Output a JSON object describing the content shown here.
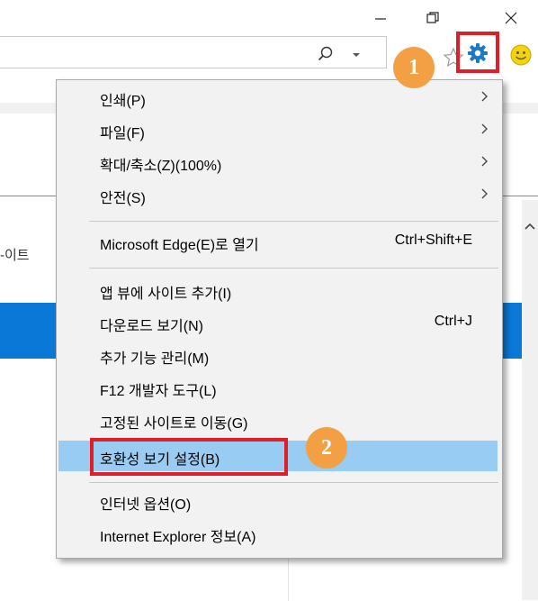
{
  "window_controls": [
    {
      "name": "minimize-icon"
    },
    {
      "name": "restore-icon"
    },
    {
      "name": "close-icon"
    }
  ],
  "toolbar": {
    "icons": [
      "search-icon",
      "chevron-down-icon",
      "star-icon",
      "gear-icon",
      "smiley-icon"
    ],
    "accent_highlight": "#e01e28",
    "callout_color": "#f2a043"
  },
  "callouts": [
    "1",
    "2"
  ],
  "background_page": {
    "tab_text": "-이트",
    "accent": "#0a78d7"
  },
  "menu": {
    "highlight_color": "#99ccf2",
    "items": [
      {
        "label": "인쇄(P)",
        "shortcut": "",
        "has_submenu": true
      },
      {
        "label": "파일(F)",
        "shortcut": "",
        "has_submenu": true
      },
      {
        "label": "확대/축소(Z)(100%)",
        "shortcut": "",
        "has_submenu": true
      },
      {
        "label": "안전(S)",
        "shortcut": "",
        "has_submenu": true
      },
      {
        "label": "Microsoft Edge(E)로 열기",
        "shortcut": "Ctrl+Shift+E",
        "has_submenu": false
      },
      {
        "label": "앱 뷰에 사이트 추가(I)",
        "shortcut": "",
        "has_submenu": false
      },
      {
        "label": "다운로드 보기(N)",
        "shortcut": "Ctrl+J",
        "has_submenu": false
      },
      {
        "label": "추가 기능 관리(M)",
        "shortcut": "",
        "has_submenu": false
      },
      {
        "label": "F12 개발자 도구(L)",
        "shortcut": "",
        "has_submenu": false
      },
      {
        "label": "고정된 사이트로 이동(G)",
        "shortcut": "",
        "has_submenu": false
      },
      {
        "label": "호환성 보기 설정(B)",
        "shortcut": "",
        "has_submenu": false,
        "highlighted": true
      },
      {
        "label": "인터넷 옵션(O)",
        "shortcut": "",
        "has_submenu": false
      },
      {
        "label": "Internet Explorer 정보(A)",
        "shortcut": "",
        "has_submenu": false
      }
    ]
  }
}
